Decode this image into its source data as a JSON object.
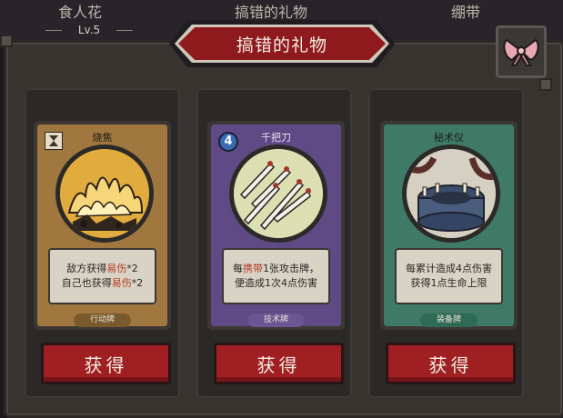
{
  "header": {
    "tab_left": "食人花",
    "tab_left_level": "Lv.5",
    "tab_center": "搞错的礼物",
    "tab_right": "绷带"
  },
  "dialog": {
    "title": "搞错的礼物",
    "close_icon": "ribbon-bow-icon"
  },
  "cards": [
    {
      "name": "烧焦",
      "cost": "",
      "cost_icon": "hourglass-icon",
      "art_icon": "burning-flame-icon",
      "desc_line1": {
        "pre": "敌方获得",
        "hl": "易伤",
        "post": "*2"
      },
      "desc_line2": {
        "pre": "自己也获得",
        "hl": "易伤",
        "post": "*2"
      },
      "type": "行动牌",
      "frame_color": "#a0783f",
      "type_color": "#7a5a2c",
      "button": "获得"
    },
    {
      "name": "千把刀",
      "cost": "4",
      "art_icon": "flying-knives-icon",
      "desc_line1": {
        "pre": "每",
        "hl": "携带",
        "post": "1张攻击牌，"
      },
      "desc_line2": {
        "pre": "便造成1次4点伤害",
        "hl": "",
        "post": ""
      },
      "type": "技术牌",
      "frame_color": "#5f4a86",
      "type_color": "#6b5592",
      "button": "获得"
    },
    {
      "name": "秘术仪",
      "cost": "",
      "art_icon": "ritual-altar-icon",
      "desc_line1": {
        "pre": "每累计造成4点伤害",
        "hl": "",
        "post": ""
      },
      "desc_line2": {
        "pre": "获得1点生命上限",
        "hl": "",
        "post": ""
      },
      "type": "装备牌",
      "frame_color": "#3f7a66",
      "type_color": "#2f6a56",
      "button": "获得"
    }
  ]
}
